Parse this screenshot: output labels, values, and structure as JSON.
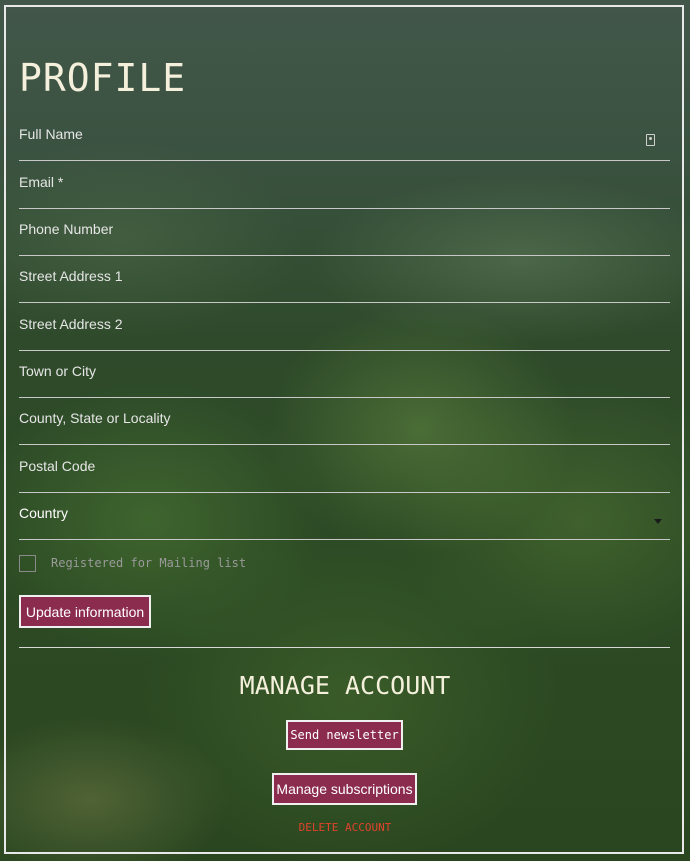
{
  "profile": {
    "title": "PROFILE",
    "fields": [
      {
        "label": "Full Name"
      },
      {
        "label": "Email *"
      },
      {
        "label": "Phone Number"
      },
      {
        "label": "Street Address 1"
      },
      {
        "label": "Street Address 2"
      },
      {
        "label": "Town or City"
      },
      {
        "label": "County, State or Locality"
      },
      {
        "label": "Postal Code"
      },
      {
        "label": "Country"
      }
    ],
    "mailing_label": "Registered for Mailing list",
    "update_button": "Update information"
  },
  "manage": {
    "title": "MANAGE ACCOUNT",
    "newsletter_button": "Send newsletter",
    "subscriptions_button": "Manage subscriptions",
    "delete_link": "DELETE ACCOUNT"
  },
  "colors": {
    "button": "#8b2b4e",
    "delete": "#e0432c",
    "heading": "#f4f0dc"
  },
  "icons": {
    "full_name": "contact-card-icon",
    "country": "chevron-down-icon"
  }
}
